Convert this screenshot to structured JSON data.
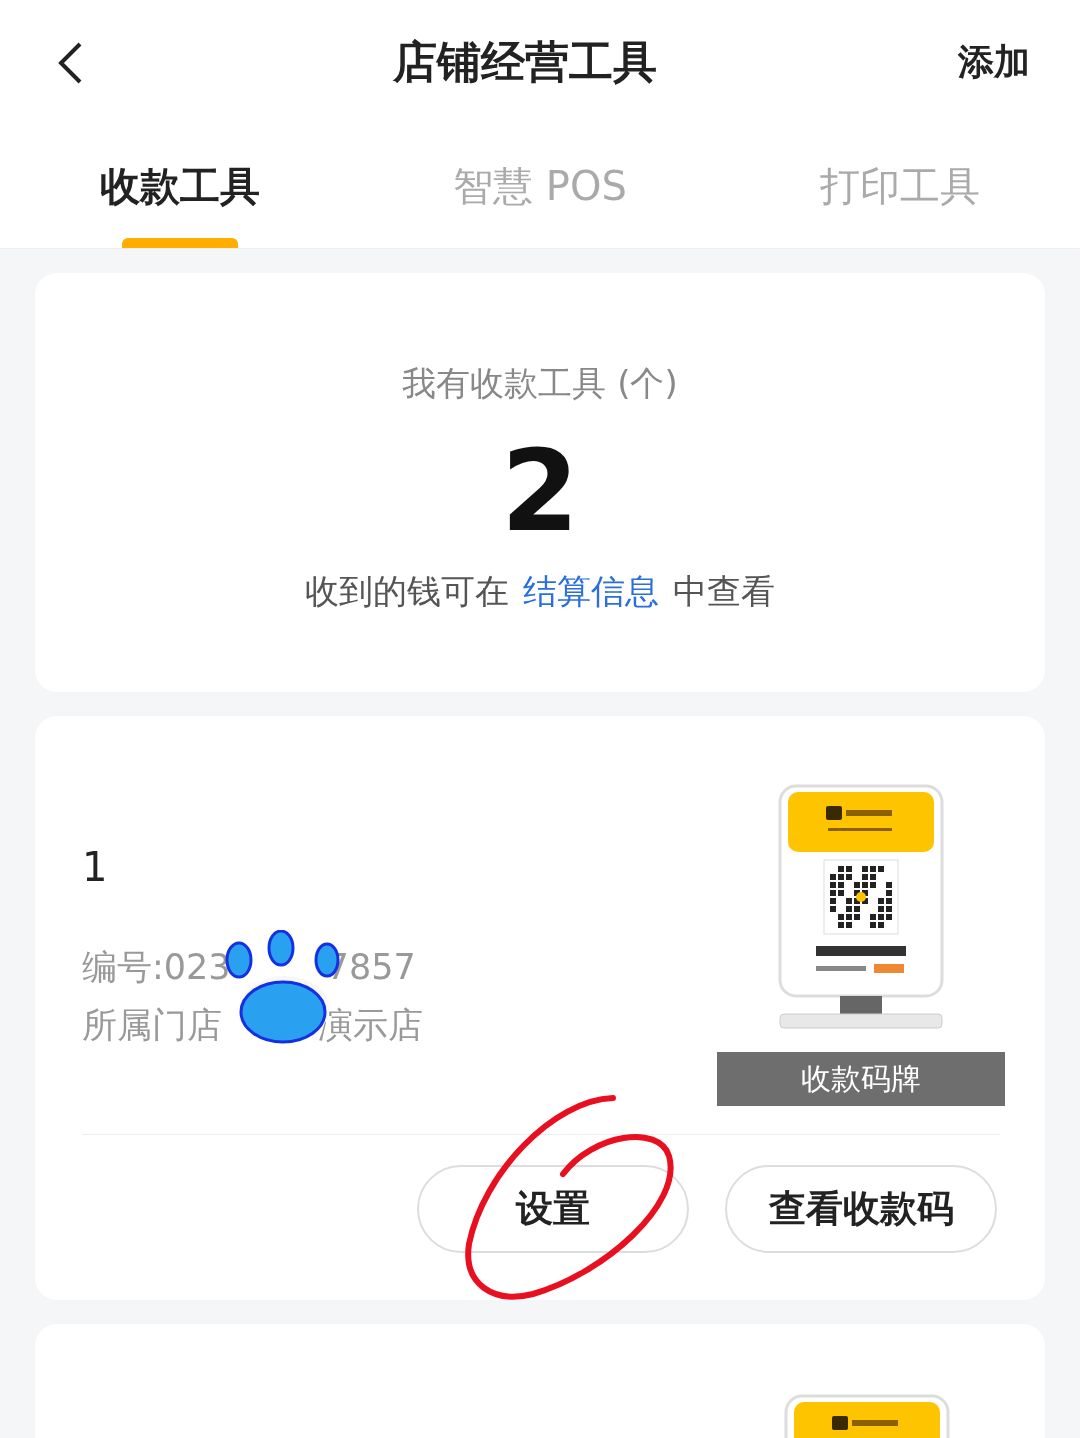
{
  "header": {
    "title": "店铺经营工具",
    "action": "添加"
  },
  "tabs": [
    {
      "label": "收款工具",
      "selected": true
    },
    {
      "label": "智慧 POS",
      "selected": false
    },
    {
      "label": "打印工具",
      "selected": false
    }
  ],
  "summary": {
    "title": "我有收款工具 (个)",
    "count": "2",
    "note_before": "收到的钱可在",
    "note_link": "结算信息",
    "note_after": "中查看"
  },
  "tools": [
    {
      "kind": "full",
      "index": "1",
      "number_prefix": "编号:023",
      "number_suffix": "7857",
      "store_prefix": "所属门店",
      "store_suffix": "演示店",
      "image_caption": "收款码牌",
      "buttons": [
        "设置",
        "查看收款码"
      ]
    },
    {
      "kind": "cut"
    }
  ]
}
